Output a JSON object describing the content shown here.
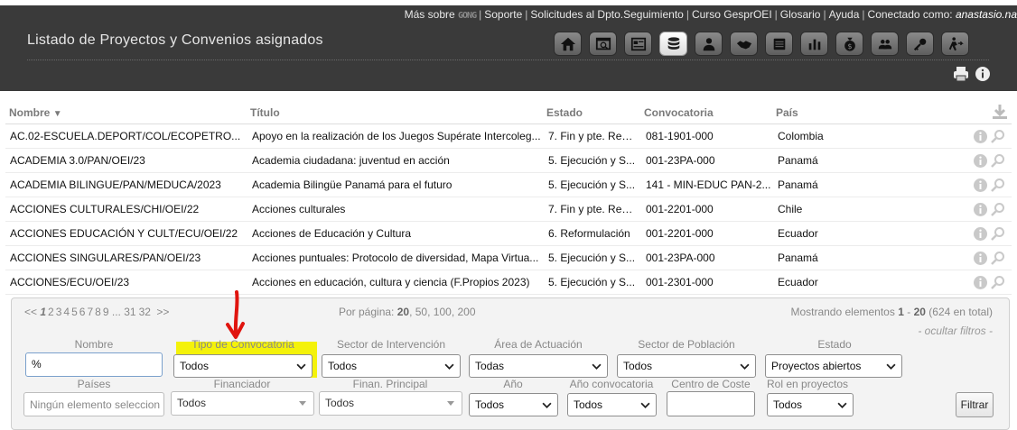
{
  "header": {
    "links": {
      "mas_sobre": "Más sobre",
      "gong": "GONG",
      "soporte": "Soporte",
      "solicitudes": "Solicitudes al Dpto.Seguimiento",
      "curso": "Curso GesprOEI",
      "glosario": "Glosario",
      "ayuda": "Ayuda",
      "conectado": "Conectado como:",
      "user": "anastasio.na"
    },
    "title": "Listado de Proyectos y Convenios asignados",
    "toolbar_icons": [
      "home-icon",
      "search-window-icon",
      "document-icon",
      "database-icon",
      "user-icon",
      "handshake-icon",
      "folder-icon",
      "bar-chart-icon",
      "money-bag-icon",
      "group-icon",
      "key-icon",
      "exit-icon"
    ]
  },
  "table": {
    "columns": {
      "nombre": "Nombre",
      "titulo": "Título",
      "estado": "Estado",
      "convocatoria": "Convocatoria",
      "pais": "País"
    },
    "rows": [
      {
        "nombre": "AC.02-ESCUELA.DEPORT/COL/ECOPETRO...",
        "titulo": "Apoyo en la realización de los Juegos Supérate Intercoleg...",
        "estado": "7. Fin y pte. Rendir",
        "convocatoria": "081-1901-000",
        "pais": "Colombia"
      },
      {
        "nombre": "ACADEMIA 3.0/PAN/OEI/23",
        "titulo": "Academia ciudadana: juventud en acción",
        "estado": "5. Ejecución y S...",
        "convocatoria": "001-23PA-000",
        "pais": "Panamá"
      },
      {
        "nombre": "ACADEMIA BILINGUE/PAN/MEDUCA/2023",
        "titulo": "Academia Bilingüe Panamá para el futuro",
        "estado": "5. Ejecución y S...",
        "convocatoria": "141 - MIN-EDUC PAN-2...",
        "pais": "Panamá"
      },
      {
        "nombre": "ACCIONES CULTURALES/CHI/OEI/22",
        "titulo": "Acciones culturales",
        "estado": "7. Fin y pte. Rendir",
        "convocatoria": "001-2201-000",
        "pais": "Chile"
      },
      {
        "nombre": "ACCIONES EDUCACIÓN Y CULT/ECU/OEI/22",
        "titulo": "Acciones de Educación y Cultura",
        "estado": "6. Reformulación",
        "convocatoria": "001-2201-000",
        "pais": "Ecuador"
      },
      {
        "nombre": "ACCIONES SINGULARES/PAN/OEI/23",
        "titulo": "Acciones puntuales: Protocolo de diversidad, Mapa Virtua...",
        "estado": "5. Ejecución y S...",
        "convocatoria": "001-23PA-000",
        "pais": "Panamá"
      },
      {
        "nombre": "ACCIONES/ECU/OEI/23",
        "titulo": "Acciones en educación, cultura y ciencia (F.Propios 2023)",
        "estado": "5. Ejecución y S...",
        "convocatoria": "001-2301-000",
        "pais": "Ecuador"
      }
    ]
  },
  "pagination": {
    "prev": "<<",
    "current": "1",
    "pages": [
      "2",
      "3",
      "4",
      "5",
      "6",
      "7",
      "8",
      "9"
    ],
    "ellipsis": "...",
    "last_pages": [
      "31",
      "32"
    ],
    "next": ">>",
    "per_page_label": "Por página:",
    "per_page_current": "20",
    "per_page_options": [
      ", 50",
      ", 100",
      ", 200"
    ],
    "showing_prefix": "Mostrando elementos",
    "showing_from": "1",
    "showing_dash": "-",
    "showing_to": "20",
    "showing_total": "(624 en total)",
    "hide_filters": "- ocultar filtros -"
  },
  "filters": {
    "nombre": {
      "label": "Nombre",
      "value": "%"
    },
    "tipo_convocatoria": {
      "label": "Tipo de Convocatoria",
      "value": "Todos"
    },
    "sector_intervencion": {
      "label": "Sector de Intervención",
      "value": "Todos"
    },
    "area_actuacion": {
      "label": "Área de Actuación",
      "value": "Todas"
    },
    "sector_poblacion": {
      "label": "Sector de Población",
      "value": "Todos"
    },
    "estado": {
      "label": "Estado",
      "value": "Proyectos abiertos"
    },
    "paises": {
      "label": "Países",
      "placeholder": "Ningún elemento seleccion"
    },
    "financiador": {
      "label": "Financiador",
      "value": "Todos"
    },
    "finan_principal": {
      "label": "Finan. Principal",
      "value": "Todos"
    },
    "anio": {
      "label": "Año",
      "value": "Todos"
    },
    "anio_convocatoria": {
      "label": "Año convocatoria",
      "value": "Todos"
    },
    "centro_coste": {
      "label": "Centro de Coste",
      "value": ""
    },
    "rol_proyectos": {
      "label": "Rol en proyectos",
      "value": "Todos"
    },
    "filtrar_button": "Filtrar"
  },
  "colors": {
    "header_bg": "#3a3a3a",
    "highlight": "#f4f20a",
    "annotation_arrow": "#e0140e"
  }
}
